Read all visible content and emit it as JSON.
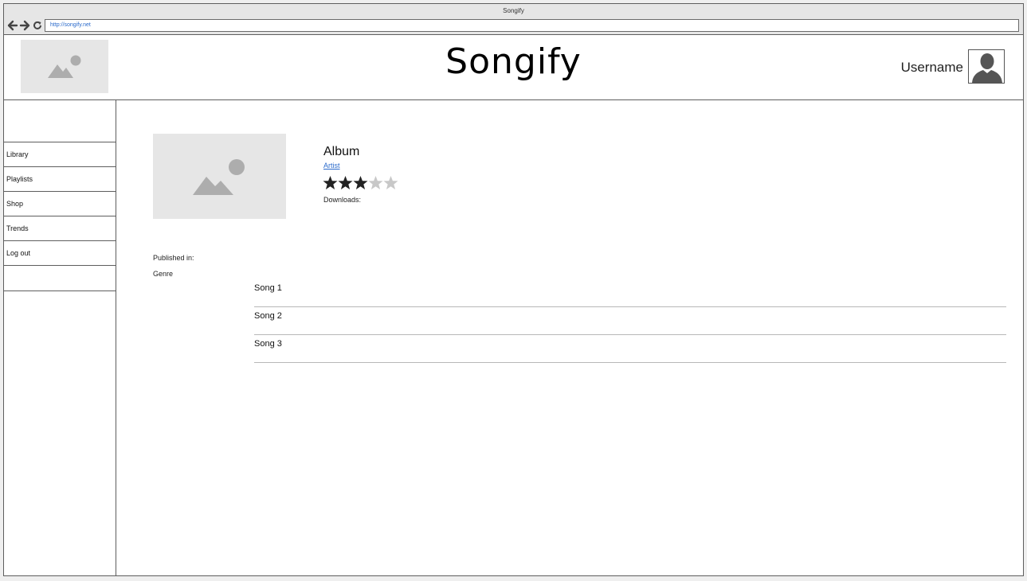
{
  "browser": {
    "title": "Songify",
    "url": "http://songify.net"
  },
  "header": {
    "brand": "Songify",
    "username": "Username"
  },
  "sidebar": {
    "items": [
      {
        "label": "Library"
      },
      {
        "label": "Playlists"
      },
      {
        "label": "Shop"
      },
      {
        "label": "Trends"
      },
      {
        "label": "Log out"
      }
    ]
  },
  "album": {
    "title": "Album",
    "artist": "Artist",
    "rating": 3,
    "rating_max": 5,
    "downloads_label": "Downloads:",
    "published_label": "Published in:",
    "genre_label": "Genre"
  },
  "songs": [
    {
      "title": "Song 1"
    },
    {
      "title": "Song 2"
    },
    {
      "title": "Song 3"
    }
  ],
  "colors": {
    "link": "#2a6acb",
    "star_filled": "#222222",
    "star_empty": "#c8c8c8",
    "placeholder_bg": "#e6e6e6",
    "placeholder_icon": "#adadad"
  }
}
